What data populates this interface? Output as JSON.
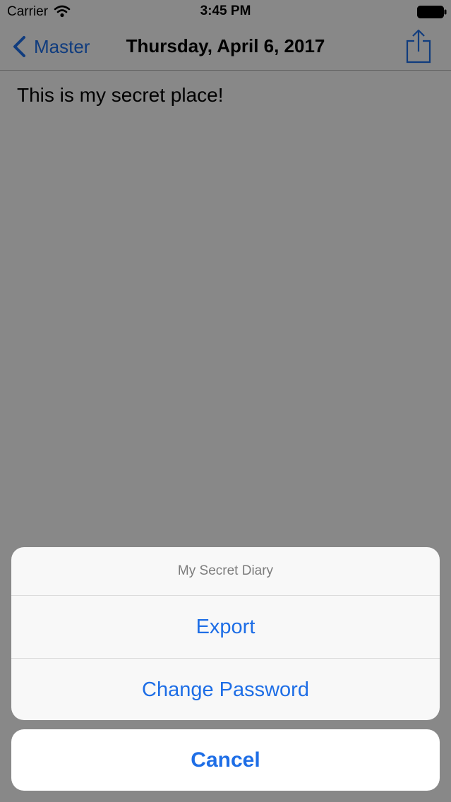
{
  "status_bar": {
    "carrier": "Carrier",
    "time": "3:45 PM"
  },
  "nav_bar": {
    "back_label": "Master",
    "title": "Thursday, April 6, 2017"
  },
  "entry": {
    "text": "This is my secret place!"
  },
  "action_sheet": {
    "title": "My Secret Diary",
    "actions": [
      {
        "label": "Export"
      },
      {
        "label": "Change Password"
      }
    ],
    "cancel_label": "Cancel"
  },
  "colors": {
    "accent": "#1e6ee6",
    "overlay": "rgba(0,0,0,0.45)"
  },
  "icons": [
    "wifi-icon",
    "battery-icon",
    "back-chevron-icon",
    "share-icon"
  ]
}
